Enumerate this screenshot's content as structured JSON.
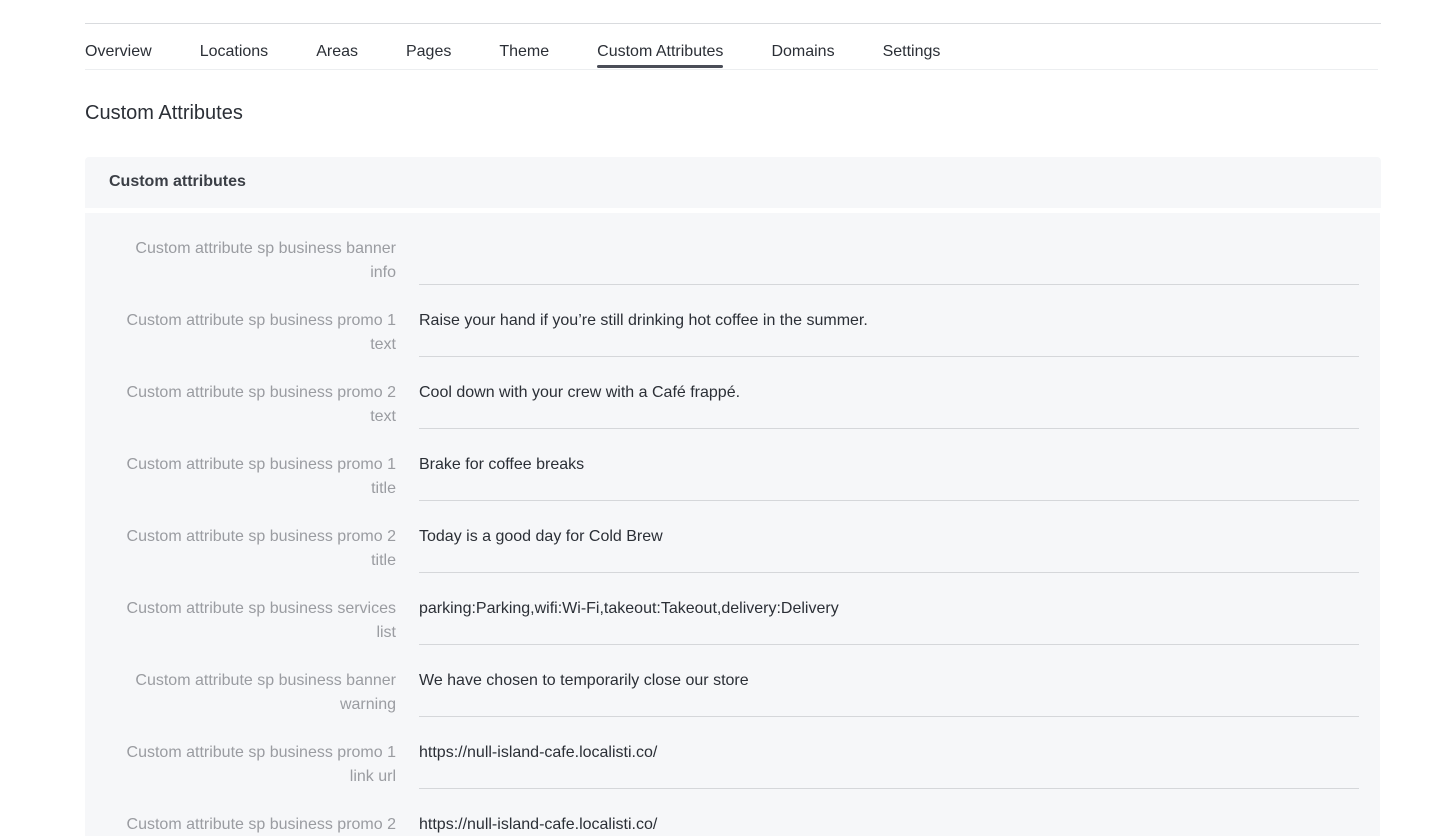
{
  "tabs": [
    {
      "label": "Overview"
    },
    {
      "label": "Locations"
    },
    {
      "label": "Areas"
    },
    {
      "label": "Pages"
    },
    {
      "label": "Theme"
    },
    {
      "label": "Custom Attributes",
      "active": true
    },
    {
      "label": "Domains"
    },
    {
      "label": "Settings"
    }
  ],
  "page_title": "Custom Attributes",
  "card": {
    "title": "Custom attributes",
    "rows": [
      {
        "label": "Custom attribute sp business banner info",
        "value": ""
      },
      {
        "label": "Custom attribute sp business promo 1 text",
        "value": "Raise your hand if you’re still drinking hot coffee in the summer."
      },
      {
        "label": "Custom attribute sp business promo 2 text",
        "value": "Cool down with your crew with a Café frappé."
      },
      {
        "label": "Custom attribute sp business promo 1 title",
        "value": "Brake for coffee breaks"
      },
      {
        "label": "Custom attribute sp business promo 2 title",
        "value": "Today is a good day for Cold Brew"
      },
      {
        "label": "Custom attribute sp business services list",
        "value": "parking:Parking,wifi:Wi-Fi,takeout:Takeout,delivery:Delivery"
      },
      {
        "label": "Custom attribute sp business banner warning",
        "value": "We have chosen to temporarily close our store"
      },
      {
        "label": "Custom attribute sp business promo 1 link url",
        "value": "https://null-island-cafe.localisti.co/"
      },
      {
        "label": "Custom attribute sp business promo 2",
        "value": "https://null-island-cafe.localisti.co/"
      }
    ]
  },
  "colors": {
    "accent": "#4a4d57",
    "card_background": "#f6f7f9",
    "label_text": "#9a9ca1"
  }
}
